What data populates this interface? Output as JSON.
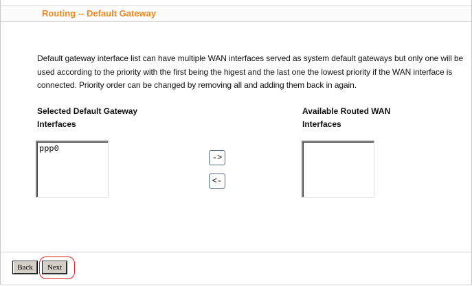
{
  "header": {
    "title": "Routing -- Default Gateway"
  },
  "description": "Default gateway interface list can have multiple WAN interfaces served as system default gateways but only one will be used according to the priority with the first being the higest and the last one the lowest priority if the WAN interface is connected. Priority order can be changed by removing all and adding them back in again.",
  "selected": {
    "heading_line1": "Selected Default Gateway",
    "heading_line2": "Interfaces",
    "options": [
      "ppp0"
    ]
  },
  "available": {
    "heading_line1": "Available Routed WAN",
    "heading_line2": "Interfaces",
    "options": []
  },
  "move_buttons": {
    "add_label": "->",
    "remove_label": "<-"
  },
  "footer": {
    "back_label": "Back",
    "next_label": "Next"
  },
  "colors": {
    "title": "#f08a24",
    "highlight_ring": "#e02020"
  }
}
